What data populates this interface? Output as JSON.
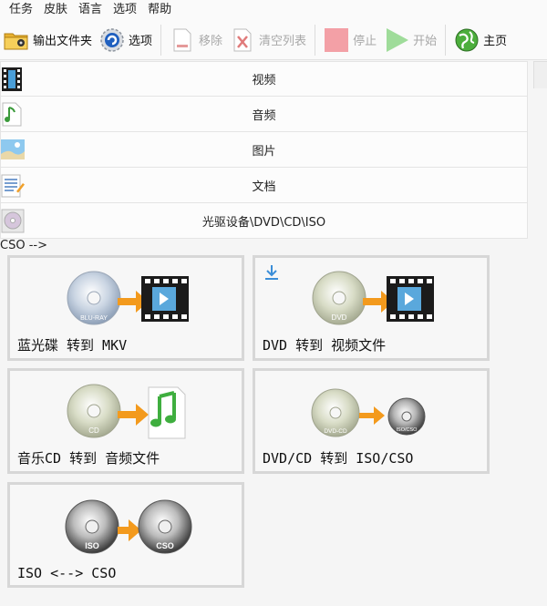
{
  "menu": [
    "任务",
    "皮肤",
    "语言",
    "选项",
    "帮助"
  ],
  "toolbar": {
    "output_folder": "输出文件夹",
    "options": "选项",
    "remove": "移除",
    "clear_list": "清空列表",
    "stop": "停止",
    "start": "开始",
    "home": "主页"
  },
  "categories": [
    "视频",
    "音频",
    "图片",
    "文档",
    "光驱设备\\DVD\\CD\\ISO"
  ],
  "tiles": {
    "bluray_mkv": {
      "label": "蓝光碟 转到 MKV",
      "disc_text": "BLU-RAY"
    },
    "dvd_video": {
      "label": "DVD 转到 视频文件",
      "disc_text": "DVD"
    },
    "cd_audio": {
      "label": "音乐CD 转到 音频文件",
      "disc_text": "CD"
    },
    "dvdcd_iso": {
      "label": "DVD/CD 转到 ISO/CSO",
      "disc_text": "DVD-CD",
      "disc_text2": "ISO/CSO"
    },
    "iso_cso": {
      "label": "ISO <--> CSO",
      "disc_text": "ISO",
      "disc_text2": "CSO"
    }
  },
  "colors": {
    "accent_orange": "#f39a1d",
    "stop_red": "#f3a0a6",
    "start_green": "#9fdc9a",
    "download_blue": "#3b8ed8"
  }
}
